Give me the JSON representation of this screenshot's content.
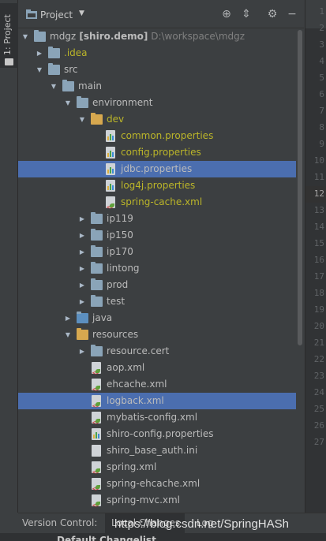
{
  "sidebar": {
    "tab_label": "1: Project",
    "tab_icon": "folder-icon"
  },
  "header": {
    "title": "Project",
    "icons": [
      "locate-icon",
      "collapse-icon",
      "gear-icon",
      "hide-icon"
    ]
  },
  "tree": [
    {
      "label": "mdgz",
      "extra": "[shiro.demo]",
      "path": "D:\\workspace\\mdgz",
      "icon": "module-icon",
      "expanded": true,
      "depth": 0
    },
    {
      "label": ".idea",
      "icon": "folder-icon",
      "expanded": false,
      "depth": 1,
      "color": "olive"
    },
    {
      "label": "src",
      "icon": "folder-icon",
      "expanded": true,
      "depth": 1
    },
    {
      "label": "main",
      "icon": "folder-icon",
      "expanded": true,
      "depth": 2
    },
    {
      "label": "environment",
      "icon": "folder-icon",
      "expanded": true,
      "depth": 3
    },
    {
      "label": "dev",
      "icon": "resource-folder-icon",
      "expanded": true,
      "depth": 4,
      "color": "olive"
    },
    {
      "label": "common.properties",
      "icon": "properties-file-icon",
      "depth": 5,
      "color": "olive"
    },
    {
      "label": "config.properties",
      "icon": "properties-file-icon",
      "depth": 5,
      "color": "olive"
    },
    {
      "label": "jdbc.properties",
      "icon": "properties-file-icon",
      "depth": 5,
      "selected": true
    },
    {
      "label": "log4j.properties",
      "icon": "properties-file-icon",
      "depth": 5,
      "color": "olive"
    },
    {
      "label": "spring-cache.xml",
      "icon": "xml-file-icon",
      "depth": 5,
      "color": "olive"
    },
    {
      "label": "ip119",
      "icon": "folder-icon",
      "expanded": false,
      "depth": 4
    },
    {
      "label": "ip150",
      "icon": "folder-icon",
      "expanded": false,
      "depth": 4
    },
    {
      "label": "ip170",
      "icon": "folder-icon",
      "expanded": false,
      "depth": 4
    },
    {
      "label": "lintong",
      "icon": "folder-icon",
      "expanded": false,
      "depth": 4
    },
    {
      "label": "prod",
      "icon": "folder-icon",
      "expanded": false,
      "depth": 4
    },
    {
      "label": "test",
      "icon": "folder-icon",
      "expanded": false,
      "depth": 4
    },
    {
      "label": "java",
      "icon": "source-folder-icon",
      "expanded": false,
      "depth": 3
    },
    {
      "label": "resources",
      "icon": "resource-folder-icon",
      "expanded": true,
      "depth": 3
    },
    {
      "label": "resource.cert",
      "icon": "folder-icon",
      "expanded": false,
      "depth": 4
    },
    {
      "label": "aop.xml",
      "icon": "xml-file-icon",
      "depth": 4
    },
    {
      "label": "ehcache.xml",
      "icon": "xml-file-icon",
      "depth": 4
    },
    {
      "label": "logback.xml",
      "icon": "xml-file-icon",
      "depth": 4,
      "selected": true
    },
    {
      "label": "mybatis-config.xml",
      "icon": "xml-file-icon",
      "depth": 4
    },
    {
      "label": "shiro-config.properties",
      "icon": "properties-file-icon",
      "depth": 4
    },
    {
      "label": "shiro_base_auth.ini",
      "icon": "text-file-icon",
      "depth": 4
    },
    {
      "label": "spring.xml",
      "icon": "xml-file-icon",
      "depth": 4
    },
    {
      "label": "spring-ehcache.xml",
      "icon": "xml-file-icon",
      "depth": 4
    },
    {
      "label": "spring-mvc.xml",
      "icon": "xml-file-icon",
      "depth": 4
    }
  ],
  "gutter": {
    "line_numbers": [
      "1",
      "2",
      "3",
      "4",
      "5",
      "6",
      "7",
      "8",
      "9",
      "10",
      "11",
      "12",
      "13",
      "14",
      "15",
      "16",
      "17",
      "18",
      "19",
      "20",
      "21",
      "22",
      "23",
      "24",
      "25",
      "26",
      "27"
    ],
    "current_line": "12"
  },
  "bottom": {
    "version_control": "Version Control:",
    "local_changes": "Local Changes",
    "log": "Log"
  },
  "changelist": "Default Changelist",
  "watermark": "https://blog.csdn.net/SpringHASh",
  "colors": {
    "selection": "#4b6eaf",
    "olive_text": "#bbb529",
    "background": "#3c3f41"
  }
}
